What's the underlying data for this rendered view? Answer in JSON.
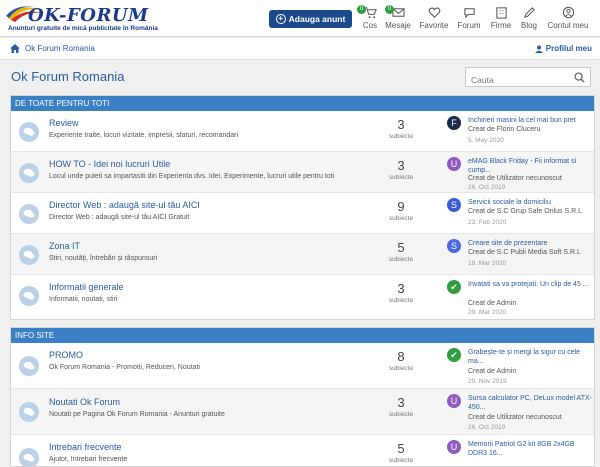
{
  "header": {
    "logo_text": "OK-FORUM",
    "logo_tagline": "Anunțuri gratuite de mică publicitate în România",
    "post_button": "Adauga anunt",
    "nav": [
      {
        "label": "Cos",
        "icon": "cart-icon",
        "badge": "0"
      },
      {
        "label": "Mesaje",
        "icon": "mail-icon",
        "badge": "0"
      },
      {
        "label": "Favorite",
        "icon": "heart-icon"
      },
      {
        "label": "Forum",
        "icon": "chat-icon"
      },
      {
        "label": "Firme",
        "icon": "building-icon"
      },
      {
        "label": "Blog",
        "icon": "pencil-icon"
      },
      {
        "label": "Contul meu",
        "icon": "user-icon"
      }
    ]
  },
  "breadcrumb": {
    "label": "Ok Forum Romania"
  },
  "profile_link": "Profilul meu",
  "page_title": "Ok Forum Romania",
  "search": {
    "placeholder": "Cauta"
  },
  "colors": {
    "accent": "#3b7fc4",
    "brand": "#1b4a8c",
    "link": "#2a5d9f"
  },
  "sections": [
    {
      "title": "DE TOATE PENTRU TOTI",
      "forums": [
        {
          "title": "Review",
          "description": "Experiente traite, locuri vizitate, impresii, sfaturi, recomandari",
          "count": "3",
          "count_label": "subiecte",
          "last_title": "Inchirieri masini la cel mai bun pret",
          "last_by": "Creat de Florin Cluceru",
          "last_date": "5. May 2020",
          "avatar": "F",
          "avatar_color": "#1e2a4a"
        },
        {
          "title": "HOW TO - Idei noi lucruri Utile",
          "description": "Locul unde puteti sa impartasiti din Experienta dvs. Idei, Experimente, lucruri utile pentru toti",
          "count": "3",
          "count_label": "subiecte",
          "last_title": "eMAG Black Friday - Fii informat si cump...",
          "last_by": "Creat de Utilizator necunoscut",
          "last_date": "26. Oct 2019",
          "avatar": "U",
          "avatar_color": "#8e5bc4"
        },
        {
          "title": "Director Web : adaugă site-ul tău AICI",
          "description": "Director Web : adaugă site-ul tău AICI Gratuit",
          "count": "9",
          "count_label": "subiecte",
          "last_title": "Servicii sociale la domiciliu",
          "last_by": "Creat de S.C Grup Safe Onlus S.R.L",
          "last_date": "23. Feb 2020",
          "avatar": "S",
          "avatar_color": "#3b5bd6"
        },
        {
          "title": "Zona IT",
          "description": "Stiri, noutăți, întrebări și răspunsuri",
          "count": "5",
          "count_label": "subiecte",
          "last_title": "Creare site de prezentare",
          "last_by": "Creat de S.C Publi Media Soft S.R.L",
          "last_date": "18. Mar 2020",
          "avatar": "S",
          "avatar_color": "#4a6ae0"
        },
        {
          "title": "Informatii generale",
          "description": "Informatii, noutati, stiri",
          "count": "3",
          "count_label": "subiecte",
          "last_title": "Invatati sa va protejati. Un clip de 45 ...",
          "last_by": "Creat de Admin",
          "last_date": "29. Mar 2020",
          "avatar": "✔",
          "avatar_color": "#2e9e3e"
        }
      ]
    },
    {
      "title": "INFO SITE",
      "forums": [
        {
          "title": "PROMO",
          "description": "Ok Forum Romania - Promotii, Reduceri, Noutati",
          "count": "8",
          "count_label": "subiecte",
          "last_title": "Grabește-te și mergi la sigur cu cele ma...",
          "last_by": "Creat de Admin",
          "last_date": "20. Nov 2019",
          "avatar": "✔",
          "avatar_color": "#2e9e3e"
        },
        {
          "title": "Noutati Ok Forum",
          "description": "Noutati pe Pagina Ok Forum Romania - Anunturi gratuite",
          "count": "3",
          "count_label": "subiecte",
          "last_title": "Sursa calculator PC, DeLux model ATX-450...",
          "last_by": "Creat de Utilizator necunoscut",
          "last_date": "26. Oct 2019",
          "avatar": "U",
          "avatar_color": "#8e5bc4"
        },
        {
          "title": "Intrebari frecvente",
          "description": "Ajutor, Intrebari frecvente",
          "count": "5",
          "count_label": "subiecte",
          "last_title": "Memorii Patriot G2 kit 8GB 2x4GB DDR3 16...",
          "last_by": "Creat de Utilizator necunoscut",
          "last_date": "26. Oct 2019",
          "avatar": "U",
          "avatar_color": "#8e5bc4"
        }
      ]
    }
  ]
}
